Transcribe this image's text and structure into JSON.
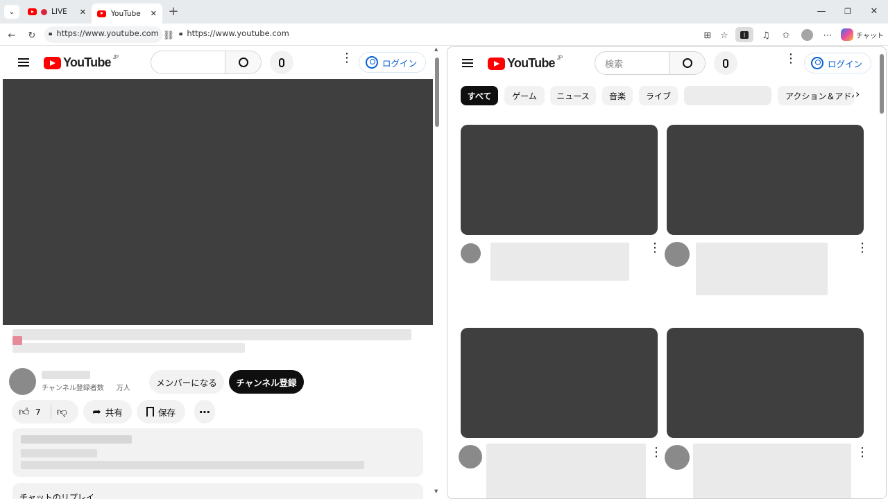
{
  "browser": {
    "tabs": [
      {
        "label": "LIVE",
        "active": false
      },
      {
        "label": "YouTube",
        "active": true
      }
    ],
    "new_tab": "+",
    "url_left": "https://www.youtube.com",
    "url_right": "https://www.youtube.com",
    "copilot_label": "チャット",
    "window_controls": {
      "minimize": "—",
      "restore": "❐",
      "close": "✕"
    }
  },
  "left_pane": {
    "logo": "YouTube",
    "logo_region": "JP",
    "search_placeholder": "",
    "login_label": "ログイン",
    "channel_subs_label": "チャンネル登録者数",
    "channel_subs_unit": "万人",
    "member_button": "メンバーになる",
    "subscribe_button": "チャンネル登録",
    "like_count": "7",
    "share_label": "共有",
    "save_label": "保存",
    "chat_replay_label": "チャットのリプレイ"
  },
  "right_pane": {
    "logo": "YouTube",
    "logo_region": "JP",
    "search_placeholder": "検索",
    "login_label": "ログイン",
    "chips": [
      "すべて",
      "ゲーム",
      "ニュース",
      "音楽",
      "ライブ",
      "",
      "アクション＆アドベ"
    ]
  },
  "colors": {
    "brand_red": "#ff0000",
    "link_blue": "#065fd4",
    "player_bg": "#3f3f3f"
  }
}
